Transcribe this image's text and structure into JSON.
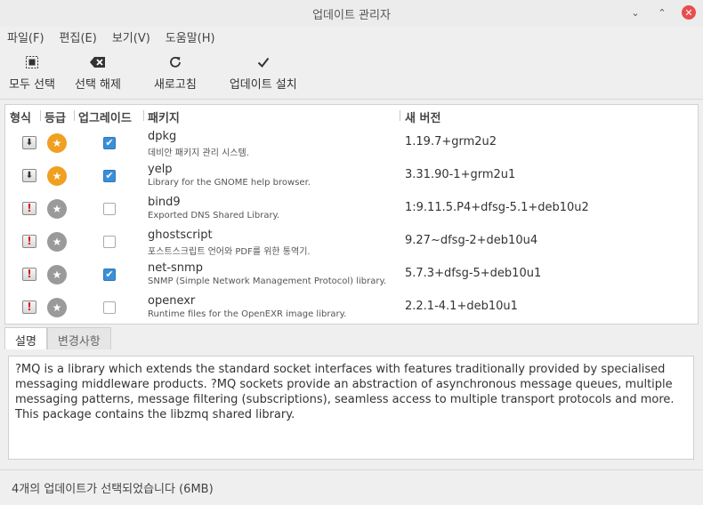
{
  "window": {
    "title": "업데이트 관리자",
    "controls": [
      "⌄",
      "⌃",
      "✕"
    ]
  },
  "menu": {
    "items": [
      "파일(F)",
      "편집(E)",
      "보기(V)",
      "도움말(H)"
    ]
  },
  "toolbar": {
    "select_all": "모두 선택",
    "deselect": "선택 해제",
    "refresh": "새로고침",
    "install": "업데이트 설치"
  },
  "columns": {
    "type": "형식",
    "level": "등급",
    "upgrade": "업그레이드",
    "package": "패키지",
    "new_version": "새 버전"
  },
  "packages": [
    {
      "name": "dpkg",
      "description": "데비안 패키지 관리 시스템.",
      "version": "1.19.7+grm2u2",
      "type_icon": "package-icon",
      "level_icon": "star-icon",
      "level_color": "#f0a020",
      "checked": true
    },
    {
      "name": "yelp",
      "description": "Library for the GNOME help browser.",
      "version": "3.31.90-1+grm2u1",
      "type_icon": "package-icon",
      "level_icon": "star-icon",
      "level_color": "#f0a020",
      "checked": true
    },
    {
      "name": "bind9",
      "description": "Exported DNS Shared Library.",
      "version": "1:9.11.5.P4+dfsg-5.1+deb10u2",
      "type_icon": "security-icon",
      "level_icon": "star-icon",
      "level_color": "#9a9a9a",
      "checked": false
    },
    {
      "name": "ghostscript",
      "description": "포스트스크립트 언어와 PDF를 위한 통역기.",
      "version": "9.27~dfsg-2+deb10u4",
      "type_icon": "security-icon",
      "level_icon": "star-icon",
      "level_color": "#9a9a9a",
      "checked": false
    },
    {
      "name": "net-snmp",
      "description": "SNMP (Simple Network Management Protocol) library.",
      "version": "5.7.3+dfsg-5+deb10u1",
      "type_icon": "security-icon",
      "level_icon": "star-icon",
      "level_color": "#9a9a9a",
      "checked": true
    },
    {
      "name": "openexr",
      "description": "Runtime files for the OpenEXR image library.",
      "version": "2.2.1-4.1+deb10u1",
      "type_icon": "security-icon",
      "level_icon": "star-icon",
      "level_color": "#9a9a9a",
      "checked": false
    }
  ],
  "tabs": [
    "설명",
    "변경사항"
  ],
  "description": "?MQ is a library which extends the standard socket interfaces with features traditionally provided by specialised messaging middleware products. ?MQ sockets provide an abstraction of asynchronous message queues, multiple messaging patterns, message filtering (subscriptions), seamless access to multiple transport protocols and more. This package contains the libzmq shared library.",
  "status": "4개의 업데이트가 선택되었습니다 (6MB)",
  "colors": {
    "accent": "#3a8fd8",
    "close": "#e84d4d",
    "security": "#d62020"
  }
}
